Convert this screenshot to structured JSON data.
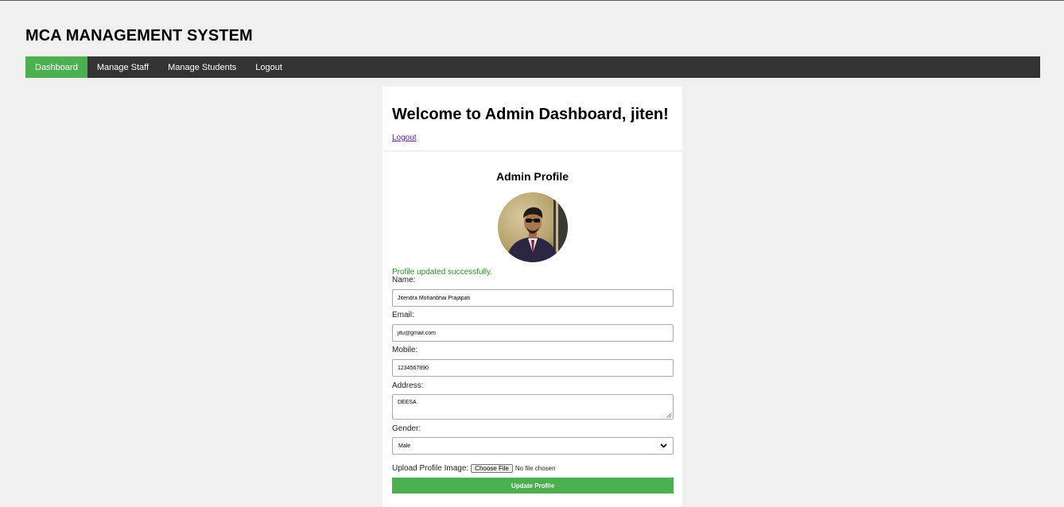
{
  "site": {
    "title": "MCA MANAGEMENT SYSTEM"
  },
  "nav": {
    "items": [
      {
        "label": "Dashboard",
        "active": true
      },
      {
        "label": "Manage Staff"
      },
      {
        "label": "Manage Students"
      },
      {
        "label": "Logout"
      }
    ]
  },
  "welcome": {
    "title": "Welcome to Admin Dashboard, jiten!",
    "logout_link": "Logout"
  },
  "profile": {
    "title": "Admin Profile",
    "avatar_icon": "admin-avatar-photo",
    "success_message": "Profile updated successfully.",
    "name_label": "Name:",
    "name_value": "Jitendra Mohanbhai Prajapati",
    "email_label": "Email:",
    "email_value": "jitu@gmail.com",
    "mobile_label": "Mobile:",
    "mobile_value": "1234567890",
    "address_label": "Address:",
    "address_value": "DEESA",
    "gender_label": "Gender:",
    "gender_value": "Male",
    "upload_label": "Upload Profile Image:",
    "choose_file_label": "Choose File",
    "no_file_text": "No file chosen",
    "update_button": "Update Profile"
  },
  "colors": {
    "accent": "#4caf50",
    "navbar": "#333333",
    "background": "#f0f0f0",
    "success": "#2e8b2e",
    "link": "#551a8b"
  }
}
